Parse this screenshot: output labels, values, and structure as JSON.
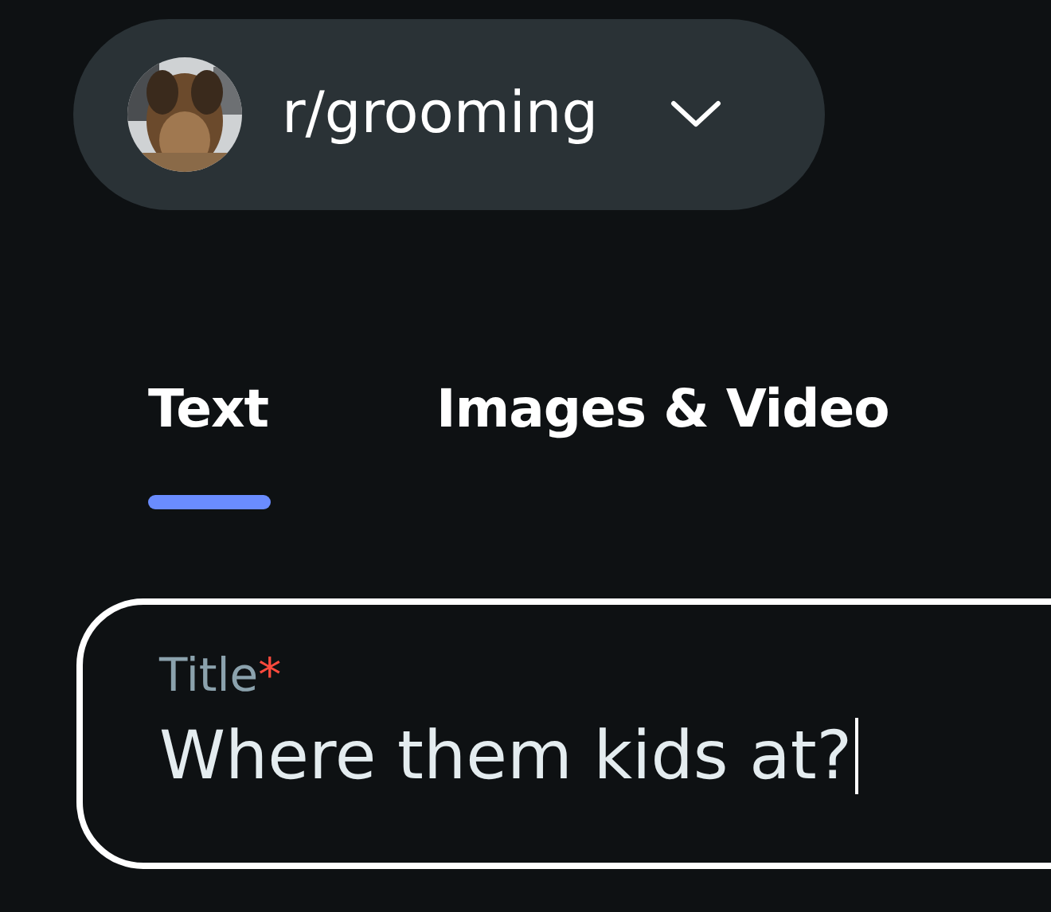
{
  "community": {
    "name": "r/grooming"
  },
  "tabs": [
    {
      "label": "Text",
      "selected": true
    },
    {
      "label": "Images & Video",
      "selected": false
    }
  ],
  "title_field": {
    "label": "Title",
    "required_mark": "*",
    "value": "Where them kids at?",
    "focused": true
  }
}
